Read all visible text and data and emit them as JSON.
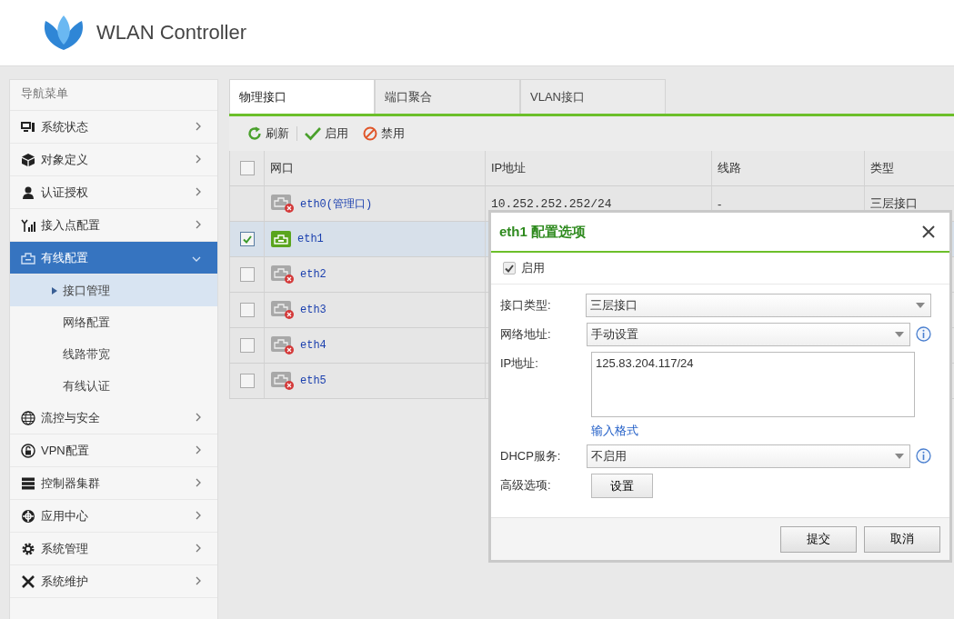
{
  "header": {
    "title": "WLAN Controller"
  },
  "sidebar": {
    "title": "导航菜单",
    "items": [
      {
        "label": "系统状态",
        "expanded": false,
        "selected": false
      },
      {
        "label": "对象定义",
        "expanded": false,
        "selected": false
      },
      {
        "label": "认证授权",
        "expanded": false,
        "selected": false
      },
      {
        "label": "接入点配置",
        "expanded": false,
        "selected": false
      },
      {
        "label": "有线配置",
        "expanded": true,
        "selected": true,
        "children": [
          {
            "label": "接口管理",
            "selected": true
          },
          {
            "label": "网络配置",
            "selected": false
          },
          {
            "label": "线路带宽",
            "selected": false
          },
          {
            "label": "有线认证",
            "selected": false
          }
        ]
      },
      {
        "label": "流控与安全",
        "expanded": false,
        "selected": false
      },
      {
        "label": "VPN配置",
        "expanded": false,
        "selected": false
      },
      {
        "label": "控制器集群",
        "expanded": false,
        "selected": false
      },
      {
        "label": "应用中心",
        "expanded": false,
        "selected": false
      },
      {
        "label": "系统管理",
        "expanded": false,
        "selected": false
      },
      {
        "label": "系统维护",
        "expanded": false,
        "selected": false
      }
    ]
  },
  "tabs": [
    {
      "label": "物理接口",
      "selected": true
    },
    {
      "label": "端口聚合",
      "selected": false
    },
    {
      "label": "VLAN接口",
      "selected": false
    }
  ],
  "toolbar": [
    {
      "kind": "refresh",
      "label": "刷新"
    },
    {
      "kind": "enable",
      "label": "启用"
    },
    {
      "kind": "disable",
      "label": "禁用"
    }
  ],
  "table": {
    "all_checked": false,
    "columns": [
      "网口",
      "IP地址",
      "线路",
      "类型"
    ],
    "rows": [
      {
        "kind": "fixed",
        "connected": false,
        "port": "eth0(管理口)",
        "ip": "10.252.252.252/24",
        "line": "-",
        "type": "三层接口"
      },
      {
        "kind": "selectable",
        "checked": true,
        "connected": true,
        "port": "eth1"
      },
      {
        "kind": "selectable",
        "checked": false,
        "connected": false,
        "port": "eth2"
      },
      {
        "kind": "selectable",
        "checked": false,
        "connected": false,
        "port": "eth3"
      },
      {
        "kind": "selectable",
        "checked": false,
        "connected": false,
        "port": "eth4"
      },
      {
        "kind": "selectable",
        "checked": false,
        "connected": false,
        "port": "eth5"
      }
    ]
  },
  "dialog": {
    "title": "eth1 配置选项",
    "enable": {
      "label": "启用",
      "checked": true
    },
    "fields": [
      {
        "kind": "select",
        "label": "接口类型:",
        "value": "三层接口",
        "info": false
      },
      {
        "kind": "select",
        "label": "网络地址:",
        "value": "手动设置",
        "info": true
      },
      {
        "kind": "textarea",
        "label": "IP地址:",
        "value": "125.83.204.117/24",
        "link": "输入格式"
      },
      {
        "kind": "select",
        "label": "DHCP服务:",
        "value": "不启用",
        "info": true
      },
      {
        "kind": "button",
        "label": "高级选项:",
        "value": "设置"
      }
    ],
    "buttons": [
      "提交",
      "取消"
    ]
  }
}
